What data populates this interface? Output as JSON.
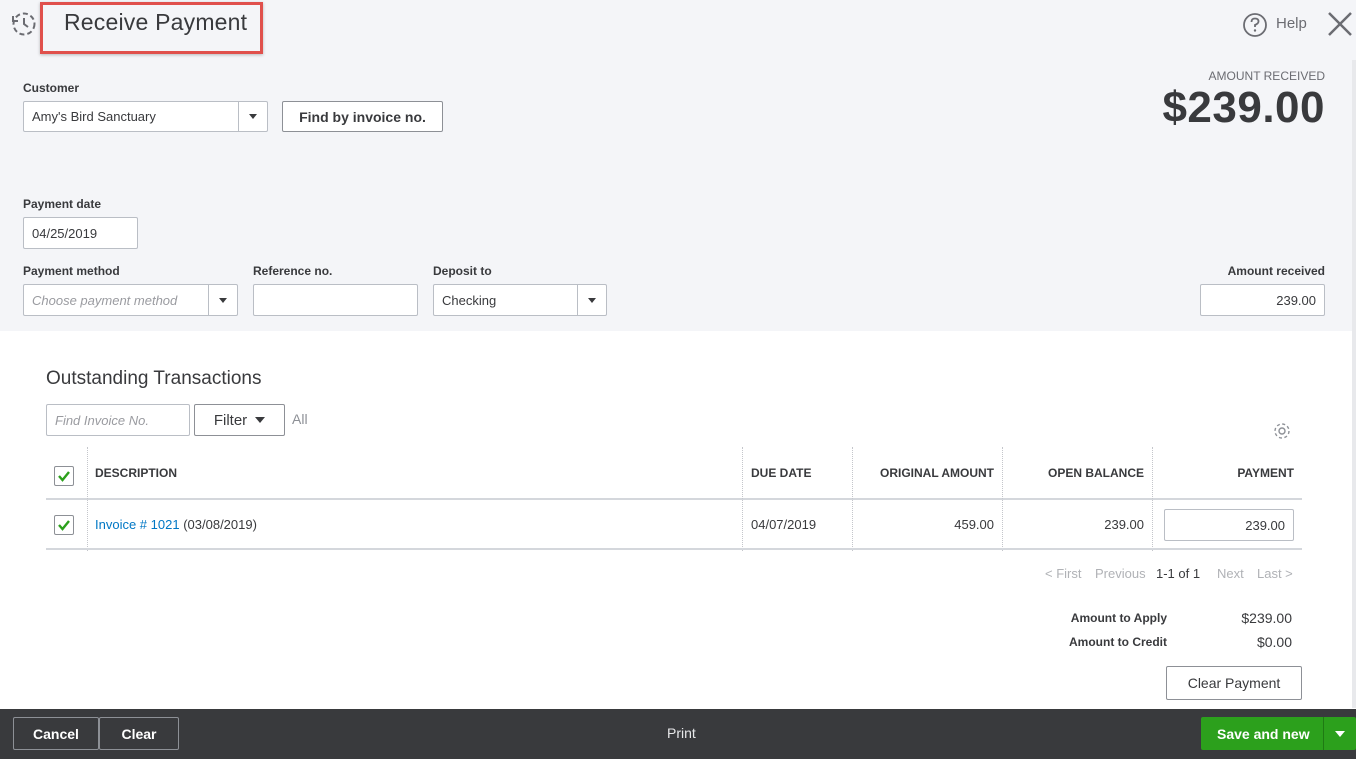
{
  "header": {
    "title": "Receive Payment",
    "help_label": "Help"
  },
  "customer": {
    "label": "Customer",
    "value": "Amy's Bird Sanctuary",
    "find_button": "Find by invoice no."
  },
  "amount_summary": {
    "label": "AMOUNT RECEIVED",
    "value": "$239.00"
  },
  "payment_date": {
    "label": "Payment date",
    "value": "04/25/2019"
  },
  "payment_method": {
    "label": "Payment method",
    "placeholder": "Choose payment method"
  },
  "reference": {
    "label": "Reference no.",
    "value": ""
  },
  "deposit_to": {
    "label": "Deposit to",
    "value": "Checking"
  },
  "amount_received": {
    "label": "Amount received",
    "value": "239.00"
  },
  "outstanding": {
    "title": "Outstanding Transactions",
    "search_placeholder": "Find Invoice No.",
    "filter_label": "Filter",
    "filter_value": "All",
    "columns": {
      "description": "DESCRIPTION",
      "due_date": "DUE DATE",
      "original_amount": "ORIGINAL AMOUNT",
      "open_balance": "OPEN BALANCE",
      "payment": "PAYMENT"
    },
    "rows": [
      {
        "invoice_link": "Invoice # 1021",
        "invoice_date": "(03/08/2019)",
        "due_date": "04/07/2019",
        "original_amount": "459.00",
        "open_balance": "239.00",
        "payment": "239.00"
      }
    ],
    "pagination": {
      "first": "< First",
      "previous": "Previous",
      "range": "1-1 of 1",
      "next": "Next",
      "last": "Last >"
    }
  },
  "totals": {
    "apply_label": "Amount to Apply",
    "apply_value": "$239.00",
    "credit_label": "Amount to Credit",
    "credit_value": "$0.00",
    "clear_payment": "Clear Payment"
  },
  "footer": {
    "cancel": "Cancel",
    "clear": "Clear",
    "print": "Print",
    "save": "Save and new"
  },
  "colors": {
    "accent_green": "#2ca01c",
    "link_blue": "#0077c5",
    "highlight_red": "#e0504c",
    "footer_bg": "#393a3d"
  }
}
